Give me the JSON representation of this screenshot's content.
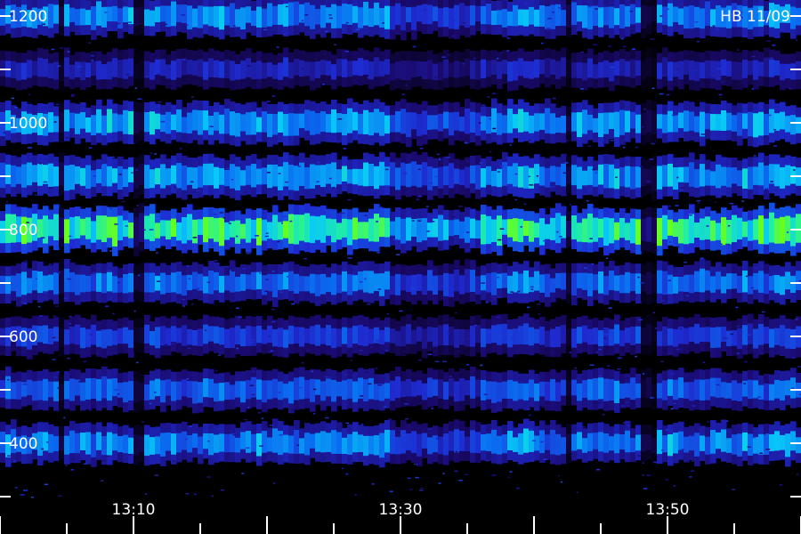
{
  "chart_data": {
    "type": "heatmap",
    "title": "",
    "annotation": "HB 11/09",
    "xlabel": "",
    "ylabel": "",
    "x_tick_labels": [
      "13:10",
      "13:30",
      "13:50"
    ],
    "x_range": [
      "13:04",
      "14:04"
    ],
    "y_tick_labels": [
      "400",
      "600",
      "800",
      "1000",
      "1200"
    ],
    "y_range": [
      300,
      1200
    ],
    "colormap": [
      "#000000",
      "#1a0a6e",
      "#1e2bd0",
      "#0a6cf0",
      "#08c8f8",
      "#22f0a0",
      "#66ff22"
    ],
    "bands": [
      {
        "center": 1200,
        "strength": 0.65
      },
      {
        "center": 1100,
        "strength": 0.35
      },
      {
        "center": 1000,
        "strength": 0.7
      },
      {
        "center": 900,
        "strength": 0.7
      },
      {
        "center": 800,
        "strength": 1.0
      },
      {
        "center": 700,
        "strength": 0.6
      },
      {
        "center": 600,
        "strength": 0.45
      },
      {
        "center": 500,
        "strength": 0.55
      },
      {
        "center": 400,
        "strength": 0.65
      }
    ]
  }
}
